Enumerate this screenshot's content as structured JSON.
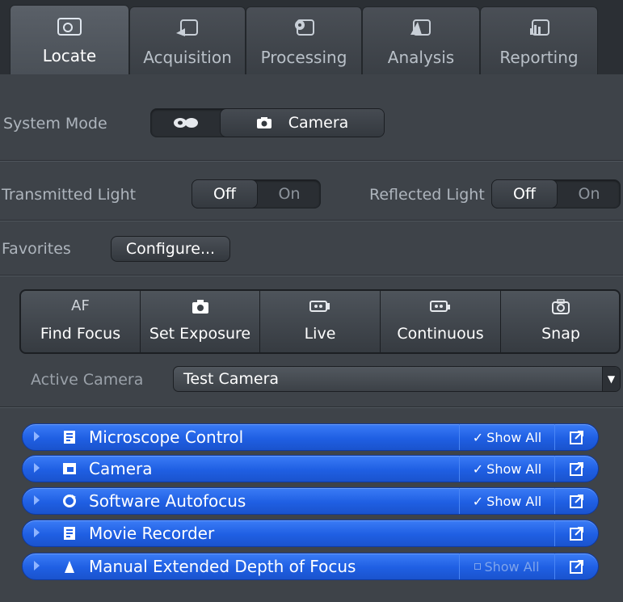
{
  "tabs": [
    {
      "label": "Locate",
      "icon": "locate-icon",
      "active": true
    },
    {
      "label": "Acquisition",
      "icon": "acquisition-icon",
      "active": false
    },
    {
      "label": "Processing",
      "icon": "processing-icon",
      "active": false
    },
    {
      "label": "Analysis",
      "icon": "analysis-icon",
      "active": false
    },
    {
      "label": "Reporting",
      "icon": "reporting-icon",
      "active": false
    }
  ],
  "system_mode": {
    "label": "System Mode",
    "options": [
      {
        "label": "",
        "icon": "eyepiece-icon",
        "selected": false
      },
      {
        "label": "Camera",
        "icon": "camera-icon",
        "selected": true
      }
    ]
  },
  "transmitted_light": {
    "label": "Transmitted Light",
    "off": "Off",
    "on": "On",
    "value": "Off"
  },
  "reflected_light": {
    "label": "Reflected Light",
    "off": "Off",
    "on": "On",
    "value": "Off"
  },
  "favorites": {
    "label": "Favorites",
    "button": "Configure..."
  },
  "toolbar": [
    {
      "label": "Find Focus",
      "icon_text": "AF",
      "icon": "autofocus-icon"
    },
    {
      "label": "Set Exposure",
      "icon": "exposure-camera-icon"
    },
    {
      "label": "Live",
      "icon": "live-icon"
    },
    {
      "label": "Continuous",
      "icon": "continuous-icon"
    },
    {
      "label": "Snap",
      "icon": "snap-icon"
    }
  ],
  "active_camera": {
    "label": "Active Camera",
    "value": "Test Camera"
  },
  "tool_windows": [
    {
      "title": "Microscope Control",
      "icon": "microscope-control-icon",
      "show_all": "Show All",
      "show_all_checked": true,
      "has_show_all": true
    },
    {
      "title": "Camera",
      "icon": "camera-tool-icon",
      "show_all": "Show All",
      "show_all_checked": true,
      "has_show_all": true
    },
    {
      "title": "Software Autofocus",
      "icon": "autofocus-tool-icon",
      "show_all": "Show All",
      "show_all_checked": true,
      "has_show_all": true
    },
    {
      "title": "Movie Recorder",
      "icon": "movie-recorder-icon",
      "show_all": "",
      "show_all_checked": false,
      "has_show_all": false
    },
    {
      "title": "Manual Extended Depth of Focus",
      "icon": "depth-focus-icon",
      "show_all": "Show All",
      "show_all_checked": false,
      "has_show_all": true
    }
  ],
  "colors": {
    "panel_blue": "#1f5fe3",
    "background": "#3e4349",
    "tab_bar": "#2b2f34"
  }
}
